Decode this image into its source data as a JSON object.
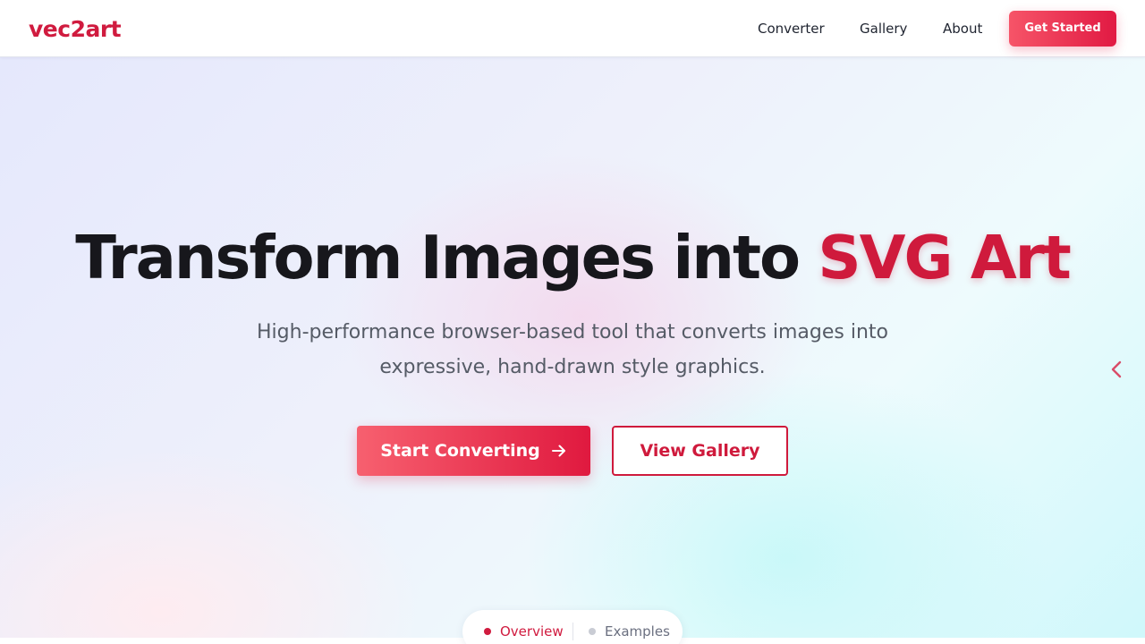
{
  "nav": {
    "logo": "vec2art",
    "links": [
      "Converter",
      "Gallery",
      "About"
    ],
    "cta": "Get Started"
  },
  "hero": {
    "title_main": "Transform Images into",
    "title_accent": "SVG Art",
    "subtitle_line1": "High-performance browser-based tool that converts images into",
    "subtitle_line2": "expressive, hand-drawn style graphics.",
    "primary_button": "Start Converting",
    "secondary_button": "View Gallery"
  },
  "section_tabs": {
    "items": [
      "Overview",
      "Examples"
    ],
    "active": "Overview"
  },
  "icons": {
    "primary_button_icon": "arrow-right-icon",
    "side_control": "chevron-left-icon"
  },
  "colors": {
    "brand": "#d01b3f",
    "accent_gradient_start": "#f7606f",
    "accent_gradient_end": "#e0193f",
    "text_dark": "#17171c",
    "text_muted": "#555b66",
    "inactive_dot": "#c9ccd4"
  }
}
